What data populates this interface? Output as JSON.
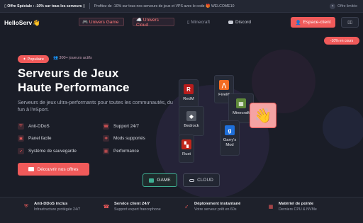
{
  "topbar": {
    "offer": "▯ Offre Spéciale : -10% sur tous les serveurs ▯",
    "promo": "Profitez de -10% sur tous nos serveurs de jeux et VPS avec le code 🎁 WELCOME10",
    "close": "Offre limitée"
  },
  "nav": {
    "logo": "HelloServ",
    "logo_emoji": "👋",
    "game": "🎮 Univers Game",
    "cloud": "☁️ Univers Cloud",
    "minecraft": "▯ Minecraft",
    "discord": "Discord",
    "client_btn": "Espace-client",
    "menu_icon": "▯▯"
  },
  "discount_chip": "-10% en cours",
  "hero": {
    "badge": "Populaire",
    "players": "300+ joueurs actifs",
    "title_line1": "Serveurs de Jeux",
    "title_line2": "Haute Performance",
    "description": "Serveurs de jeux ultra-performants pour toutes les communautés, du fun à l'eSport.",
    "features": [
      {
        "label": "Anti-DDoS",
        "icon": "shield-icon"
      },
      {
        "label": "Support 24/7",
        "icon": "headset-icon"
      },
      {
        "label": "Panel facile",
        "icon": "panel-icon"
      },
      {
        "label": "Mods supportés",
        "icon": "puzzle-icon"
      },
      {
        "label": "Système de sauvegarde",
        "icon": "rocket-icon"
      },
      {
        "label": "Performance",
        "icon": "chip-icon"
      }
    ],
    "cta": "Découvrir nos offres"
  },
  "games": {
    "redm": "RedM",
    "fivem": "FiveM",
    "minecraft": "Minecraft",
    "bedrock": "Bedrock",
    "garrys": "Garry's Mod",
    "rust": "Rust"
  },
  "toggle": {
    "game": "GAME",
    "cloud": "CLOUD"
  },
  "footer": [
    {
      "title": "Anti-DDoS inclus",
      "subtitle": "Infrastructure protégée 24/7",
      "icon": "shield-icon"
    },
    {
      "title": "Service client 24/7",
      "subtitle": "Support expert francophone",
      "icon": "headset-icon"
    },
    {
      "title": "Déploiement instantané",
      "subtitle": "Votre serveur prêt en 60s",
      "icon": "rocket-icon"
    },
    {
      "title": "Matériel de pointe",
      "subtitle": "Derniers CPU & NVMe",
      "icon": "chip-icon"
    }
  ],
  "colors": {
    "accent": "#f05a5a",
    "background": "#1a1d27",
    "teal": "#3fae92"
  }
}
